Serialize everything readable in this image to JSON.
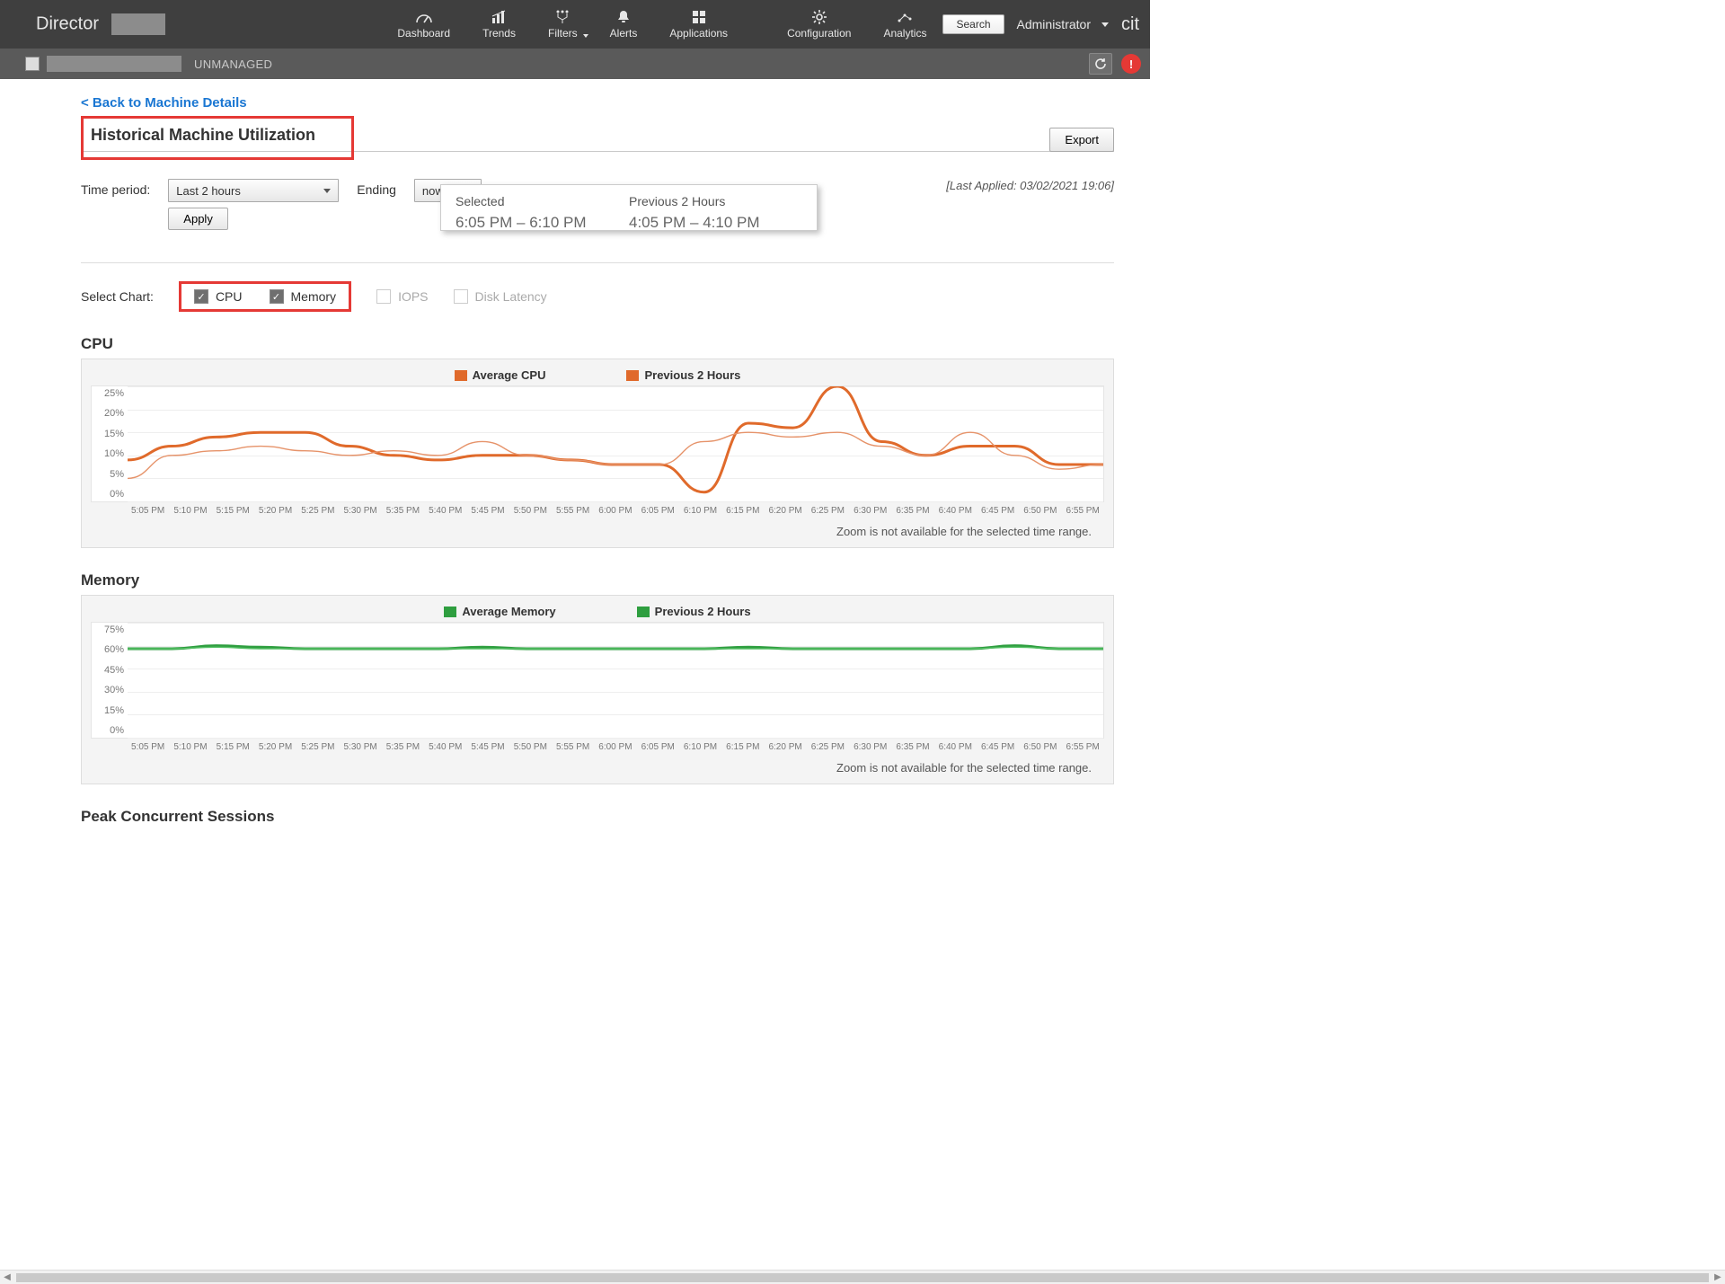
{
  "brand": "Director",
  "nav": [
    {
      "label": "Dashboard"
    },
    {
      "label": "Trends"
    },
    {
      "label": "Filters"
    },
    {
      "label": "Alerts"
    },
    {
      "label": "Applications"
    },
    {
      "label": "Configuration"
    },
    {
      "label": "Analytics"
    }
  ],
  "search_label": "Search",
  "admin_label": "Administrator",
  "right_logo": "citrix",
  "subbar": {
    "status": "UNMANAGED",
    "alert": "!"
  },
  "back_link": "< Back to Machine Details",
  "page_title": "Historical Machine Utilization",
  "export_label": "Export",
  "filters": {
    "time_period_label": "Time period:",
    "time_period_value": "Last 2 hours",
    "ending_label": "Ending",
    "ending_value": "now",
    "apply_label": "Apply",
    "last_applied": "[Last Applied: 03/02/2021 19:06]"
  },
  "popup": {
    "selected_label": "Selected",
    "selected_value": "6:05 PM – 6:10 PM",
    "previous_label": "Previous 2 Hours",
    "previous_value": "4:05 PM – 4:10 PM"
  },
  "select_chart": {
    "label": "Select Chart:",
    "cpu": "CPU",
    "memory": "Memory",
    "iops": "IOPS",
    "disk_latency": "Disk Latency"
  },
  "zoom_note": "Zoom is not available for the selected time range.",
  "x_ticks": [
    "5:05 PM",
    "5:10 PM",
    "5:15 PM",
    "5:20 PM",
    "5:25 PM",
    "5:30 PM",
    "5:35 PM",
    "5:40 PM",
    "5:45 PM",
    "5:50 PM",
    "5:55 PM",
    "6:00 PM",
    "6:05 PM",
    "6:10 PM",
    "6:15 PM",
    "6:20 PM",
    "6:25 PM",
    "6:30 PM",
    "6:35 PM",
    "6:40 PM",
    "6:45 PM",
    "6:50 PM",
    "6:55 PM"
  ],
  "cpu": {
    "title": "CPU",
    "legend": [
      {
        "name": "Average CPU",
        "color": "#e06a2b"
      },
      {
        "name": "Previous 2 Hours",
        "color": "#e06a2b"
      }
    ],
    "y_ticks": [
      "25%",
      "20%",
      "15%",
      "10%",
      "5%",
      "0%"
    ]
  },
  "memory": {
    "title": "Memory",
    "legend": [
      {
        "name": "Average Memory",
        "color": "#2e9e3f"
      },
      {
        "name": "Previous 2 Hours",
        "color": "#2e9e3f"
      }
    ],
    "y_ticks": [
      "75%",
      "60%",
      "45%",
      "30%",
      "15%",
      "0%"
    ]
  },
  "sessions_title": "Peak Concurrent Sessions",
  "chart_data": [
    {
      "type": "line",
      "title": "CPU",
      "xlabel": "",
      "ylabel": "",
      "ylim": [
        0,
        25
      ],
      "categories": [
        "5:05 PM",
        "5:10 PM",
        "5:15 PM",
        "5:20 PM",
        "5:25 PM",
        "5:30 PM",
        "5:35 PM",
        "5:40 PM",
        "5:45 PM",
        "5:50 PM",
        "5:55 PM",
        "6:00 PM",
        "6:05 PM",
        "6:10 PM",
        "6:15 PM",
        "6:20 PM",
        "6:25 PM",
        "6:30 PM",
        "6:35 PM",
        "6:40 PM",
        "6:45 PM",
        "6:50 PM",
        "6:55 PM"
      ],
      "series": [
        {
          "name": "Average CPU",
          "values": [
            9,
            12,
            14,
            15,
            15,
            12,
            10,
            9,
            10,
            10,
            9,
            8,
            8,
            2,
            17,
            16,
            25,
            13,
            10,
            12,
            12,
            8,
            8
          ]
        },
        {
          "name": "Previous 2 Hours",
          "values": [
            5,
            10,
            11,
            12,
            11,
            10,
            11,
            10,
            13,
            10,
            9,
            8,
            8,
            13,
            15,
            14,
            15,
            12,
            10,
            15,
            10,
            7,
            8
          ]
        }
      ]
    },
    {
      "type": "line",
      "title": "Memory",
      "xlabel": "",
      "ylabel": "",
      "ylim": [
        0,
        75
      ],
      "categories": [
        "5:05 PM",
        "5:10 PM",
        "5:15 PM",
        "5:20 PM",
        "5:25 PM",
        "5:30 PM",
        "5:35 PM",
        "5:40 PM",
        "5:45 PM",
        "5:50 PM",
        "5:55 PM",
        "6:00 PM",
        "6:05 PM",
        "6:10 PM",
        "6:15 PM",
        "6:20 PM",
        "6:25 PM",
        "6:30 PM",
        "6:35 PM",
        "6:40 PM",
        "6:45 PM",
        "6:50 PM",
        "6:55 PM"
      ],
      "series": [
        {
          "name": "Average Memory",
          "values": [
            58,
            58,
            60,
            59,
            58,
            58,
            58,
            58,
            59,
            58,
            58,
            58,
            58,
            58,
            59,
            58,
            58,
            58,
            58,
            58,
            60,
            58,
            58
          ]
        },
        {
          "name": "Previous 2 Hours",
          "values": [
            58,
            58,
            59,
            58,
            58,
            58,
            58,
            58,
            58,
            58,
            58,
            58,
            58,
            58,
            58,
            58,
            58,
            58,
            58,
            58,
            59,
            58,
            58
          ]
        }
      ]
    }
  ]
}
